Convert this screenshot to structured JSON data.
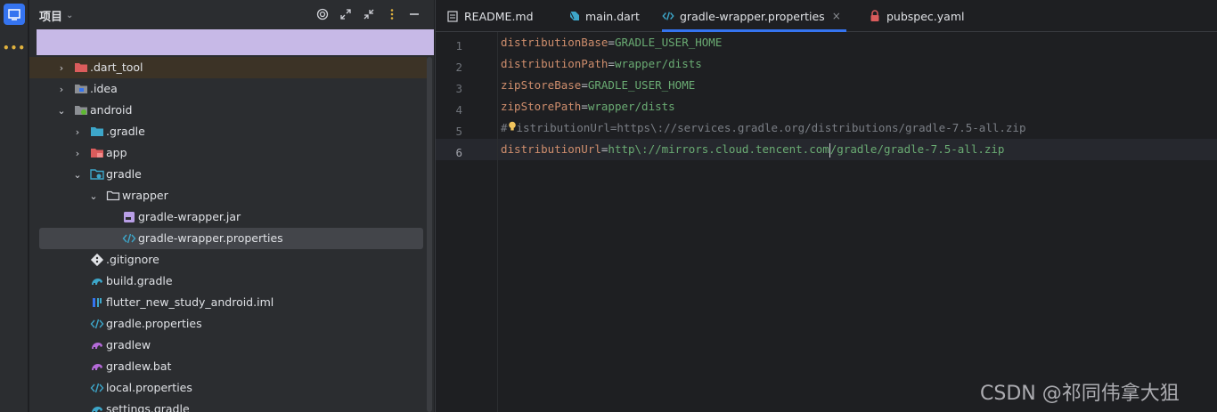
{
  "project_panel": {
    "title": "项目",
    "tree": [
      {
        "label": ".dart_tool",
        "icon": "folder-excluded-icon",
        "expanded": false
      },
      {
        "label": ".idea",
        "icon": "folder-idea-icon",
        "expanded": false
      },
      {
        "label": "android",
        "icon": "folder-android-icon",
        "expanded": true
      },
      {
        "label": ".gradle",
        "icon": "folder-gradle-icon",
        "expanded": false
      },
      {
        "label": "app",
        "icon": "folder-module-icon",
        "expanded": false
      },
      {
        "label": "gradle",
        "icon": "folder-gradle-icon",
        "expanded": true
      },
      {
        "label": "wrapper",
        "icon": "folder-icon",
        "expanded": true
      },
      {
        "label": "gradle-wrapper.jar",
        "icon": "jar-file-icon"
      },
      {
        "label": "gradle-wrapper.properties",
        "icon": "properties-file-icon",
        "selected": true
      },
      {
        "label": ".gitignore",
        "icon": "git-file-icon"
      },
      {
        "label": "build.gradle",
        "icon": "gradle-file-icon"
      },
      {
        "label": "flutter_new_study_android.iml",
        "icon": "iml-file-icon"
      },
      {
        "label": "gradle.properties",
        "icon": "properties-file-icon"
      },
      {
        "label": "gradlew",
        "icon": "gradlew-file-icon"
      },
      {
        "label": "gradlew.bat",
        "icon": "gradlew-file-icon"
      },
      {
        "label": "local.properties",
        "icon": "properties-file-icon"
      },
      {
        "label": "settings.gradle",
        "icon": "gradle-file-icon"
      }
    ]
  },
  "tabs": [
    {
      "label": "README.md",
      "icon": "markdown-file-icon"
    },
    {
      "label": "main.dart",
      "icon": "dart-file-icon"
    },
    {
      "label": "gradle-wrapper.properties",
      "icon": "properties-file-icon",
      "active": true,
      "close": "×"
    },
    {
      "label": "pubspec.yaml",
      "icon": "lock-icon"
    }
  ],
  "editor": {
    "lines": [
      {
        "num": "1",
        "key": "distributionBase",
        "eq": "=",
        "value": "GRADLE_USER_HOME"
      },
      {
        "num": "2",
        "key": "distributionPath",
        "eq": "=",
        "value": "wrapper/dists"
      },
      {
        "num": "3",
        "key": "zipStoreBase",
        "eq": "=",
        "value": "GRADLE_USER_HOME"
      },
      {
        "num": "4",
        "key": "zipStorePath",
        "eq": "=",
        "value": "wrapper/dists"
      },
      {
        "num": "5",
        "comment_a": "#",
        "comment_b": "istributionUrl=https\\://services.gradle.org/distributions/gradle-7.5-all.zip"
      },
      {
        "num": "6",
        "key": "distributionUrl",
        "eq": "=",
        "value_a": "http\\://mirrors.cloud.tencent.com",
        "value_b": "/gradle/gradle-7.5-all.zip"
      }
    ]
  },
  "watermark": "CSDN @祁同伟拿大狙",
  "colors": {
    "accent": "#3574f0",
    "key": "#c77dbb",
    "value": "#6aab73",
    "comment": "#7a7e85"
  }
}
